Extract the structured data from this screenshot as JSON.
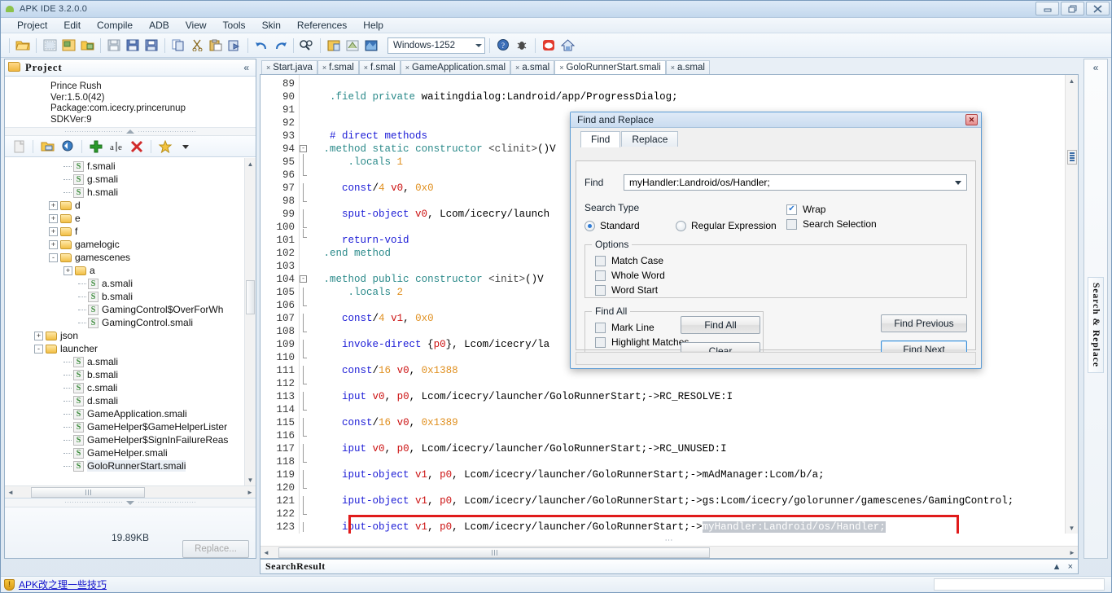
{
  "window": {
    "title": "APK IDE 3.2.0.0",
    "icon": "android-icon",
    "minimize": "minimize-icon",
    "restore": "restore-icon",
    "close": "close-icon"
  },
  "menubar": {
    "items": [
      "Project",
      "Edit",
      "Compile",
      "ADB",
      "View",
      "Tools",
      "Skin",
      "References",
      "Help"
    ]
  },
  "toolbar": {
    "encoding": "Windows-1252",
    "buttons": [
      "open-folder-icon",
      "new-project-icon",
      "import-icon",
      "export-icon",
      "save-icon",
      "save-all-icon",
      "save-as-icon",
      "copy-icon",
      "cut-icon",
      "paste-icon",
      "clipboard-icon",
      "undo-icon",
      "redo-icon",
      "find-icon",
      "build-icon",
      "sign-icon",
      "install-icon",
      "help-icon",
      "bug-icon",
      "weibo-icon",
      "home-icon"
    ]
  },
  "project_panel": {
    "title": "Project",
    "collapse": "«",
    "info": {
      "name": "Prince Rush",
      "version": "Ver:1.5.0(42)",
      "package": "Package:com.icecry.princerunup",
      "sdk": "SDKVer:9"
    },
    "tree_toolbar": [
      "new-file-icon",
      "open-file-icon",
      "refresh-icon",
      "add-icon",
      "rename-icon",
      "delete-icon",
      "favorite-icon",
      "dropdown-icon"
    ],
    "tree": [
      {
        "label": "f.smali",
        "type": "file",
        "indent": 4,
        "expander": ""
      },
      {
        "label": "g.smali",
        "type": "file",
        "indent": 4,
        "expander": ""
      },
      {
        "label": "h.smali",
        "type": "file",
        "indent": 4,
        "expander": ""
      },
      {
        "label": "d",
        "type": "folder",
        "indent": 3,
        "expander": "+"
      },
      {
        "label": "e",
        "type": "folder",
        "indent": 3,
        "expander": "+"
      },
      {
        "label": "f",
        "type": "folder",
        "indent": 3,
        "expander": "+"
      },
      {
        "label": "gamelogic",
        "type": "folder",
        "indent": 3,
        "expander": "+"
      },
      {
        "label": "gamescenes",
        "type": "folder",
        "indent": 3,
        "expander": "-"
      },
      {
        "label": "a",
        "type": "folder",
        "indent": 4,
        "expander": "+"
      },
      {
        "label": "a.smali",
        "type": "file",
        "indent": 5,
        "expander": ""
      },
      {
        "label": "b.smali",
        "type": "file",
        "indent": 5,
        "expander": ""
      },
      {
        "label": "GamingControl$OverForWh",
        "type": "file",
        "indent": 5,
        "expander": ""
      },
      {
        "label": "GamingControl.smali",
        "type": "file",
        "indent": 5,
        "expander": ""
      },
      {
        "label": "json",
        "type": "folder",
        "indent": 2,
        "expander": "+"
      },
      {
        "label": "launcher",
        "type": "folder",
        "indent": 2,
        "expander": "-"
      },
      {
        "label": "a.smali",
        "type": "file",
        "indent": 4,
        "expander": ""
      },
      {
        "label": "b.smali",
        "type": "file",
        "indent": 4,
        "expander": ""
      },
      {
        "label": "c.smali",
        "type": "file",
        "indent": 4,
        "expander": ""
      },
      {
        "label": "d.smali",
        "type": "file",
        "indent": 4,
        "expander": ""
      },
      {
        "label": "GameApplication.smali",
        "type": "file",
        "indent": 4,
        "expander": ""
      },
      {
        "label": "GameHelper$GameHelperLister",
        "type": "file",
        "indent": 4,
        "expander": ""
      },
      {
        "label": "GameHelper$SignInFailureReas",
        "type": "file",
        "indent": 4,
        "expander": ""
      },
      {
        "label": "GameHelper.smali",
        "type": "file",
        "indent": 4,
        "expander": ""
      },
      {
        "label": "GoloRunnerStart.smali",
        "type": "file",
        "indent": 4,
        "expander": "",
        "selected": true
      }
    ],
    "file_size": "19.89KB",
    "replace_button": "Replace..."
  },
  "editor": {
    "tabs": [
      {
        "label": "Start.java",
        "close": "×",
        "active": false
      },
      {
        "label": "f.smal",
        "close": "×",
        "active": false
      },
      {
        "label": "f.smal",
        "close": "×",
        "active": false
      },
      {
        "label": "GameApplication.smal",
        "close": "×",
        "active": false
      },
      {
        "label": "a.smal",
        "close": "×",
        "active": false
      },
      {
        "label": "GoloRunnerStart.smali",
        "close": "×",
        "active": true
      },
      {
        "label": "a.smal",
        "close": "×",
        "active": false
      }
    ],
    "first_line_number": 89,
    "lines": [
      {
        "n": 89,
        "text": ""
      },
      {
        "n": 90,
        "text": "  .field private waitingdialog:Landroid/app/ProgressDialog;"
      },
      {
        "n": 91,
        "text": ""
      },
      {
        "n": 92,
        "text": ""
      },
      {
        "n": 93,
        "text": "  # direct methods"
      },
      {
        "n": 94,
        "text": " .method static constructor <clinit>()V"
      },
      {
        "n": 95,
        "text": "     .locals 1"
      },
      {
        "n": 96,
        "text": ""
      },
      {
        "n": 97,
        "text": "    const/4 v0, 0x0"
      },
      {
        "n": 98,
        "text": ""
      },
      {
        "n": 99,
        "text": "    sput-object v0, Lcom/icecry/launch"
      },
      {
        "n": 100,
        "text": ""
      },
      {
        "n": 101,
        "text": "    return-void"
      },
      {
        "n": 102,
        "text": " .end method"
      },
      {
        "n": 103,
        "text": ""
      },
      {
        "n": 104,
        "text": " .method public constructor <init>()V"
      },
      {
        "n": 105,
        "text": "     .locals 2"
      },
      {
        "n": 106,
        "text": ""
      },
      {
        "n": 107,
        "text": "    const/4 v1, 0x0"
      },
      {
        "n": 108,
        "text": ""
      },
      {
        "n": 109,
        "text": "    invoke-direct {p0}, Lcom/icecry/la"
      },
      {
        "n": 110,
        "text": ""
      },
      {
        "n": 111,
        "text": "    const/16 v0, 0x1388"
      },
      {
        "n": 112,
        "text": ""
      },
      {
        "n": 113,
        "text": "    iput v0, p0, Lcom/icecry/launcher/GoloRunnerStart;->RC_RESOLVE:I"
      },
      {
        "n": 114,
        "text": ""
      },
      {
        "n": 115,
        "text": "    const/16 v0, 0x1389"
      },
      {
        "n": 116,
        "text": ""
      },
      {
        "n": 117,
        "text": "    iput v0, p0, Lcom/icecry/launcher/GoloRunnerStart;->RC_UNUSED:I"
      },
      {
        "n": 118,
        "text": ""
      },
      {
        "n": 119,
        "text": "    iput-object v1, p0, Lcom/icecry/launcher/GoloRunnerStart;->mAdManager:Lcom/b/a;"
      },
      {
        "n": 120,
        "text": ""
      },
      {
        "n": 121,
        "text": "    iput-object v1, p0, Lcom/icecry/launcher/GoloRunnerStart;->gs:Lcom/icecry/golorunner/gamescenes/GamingControl;"
      },
      {
        "n": 122,
        "text": ""
      },
      {
        "n": 123,
        "text": "    iput-object v1, p0, Lcom/icecry/launcher/GoloRunnerStart;->myHandler:Landroid/os/Handler;"
      }
    ],
    "highlight": {
      "line": 123,
      "selected_text": "myHandler:Landroid/os/Handler;",
      "box_color": "#e01b1b"
    }
  },
  "right_dock": {
    "collapse": "«",
    "tab_label": "Search & Replace"
  },
  "search_result_dock": {
    "title": "SearchResult",
    "collapse": "▲",
    "close": "×"
  },
  "statusbar": {
    "icon": "shield-icon",
    "link": "APK改之理一些技巧"
  },
  "find_dialog": {
    "title": "Find and Replace",
    "close": "✕",
    "tabs": [
      {
        "label": "Find",
        "active": true
      },
      {
        "label": "Replace",
        "active": false
      }
    ],
    "find_label": "Find",
    "find_value": "myHandler:Landroid/os/Handler;",
    "search_type_label": "Search Type",
    "search_type_options": [
      {
        "label": "Standard",
        "checked": true
      },
      {
        "label": "Regular Expression",
        "checked": false
      }
    ],
    "wrap": {
      "label": "Wrap",
      "checked": true
    },
    "search_selection": {
      "label": "Search Selection",
      "checked": false
    },
    "options_label": "Options",
    "options": [
      {
        "label": "Match Case",
        "checked": false
      },
      {
        "label": "Whole Word",
        "checked": false
      },
      {
        "label": "Word Start",
        "checked": false
      }
    ],
    "find_all_label": "Find All",
    "find_all_options": [
      {
        "label": "Mark Line",
        "checked": false
      },
      {
        "label": "Highlight Matches",
        "checked": false
      }
    ],
    "buttons": {
      "find_all": "Find All",
      "clear": "Clear",
      "find_previous": "Find Previous",
      "find_next": "Find Next"
    }
  }
}
